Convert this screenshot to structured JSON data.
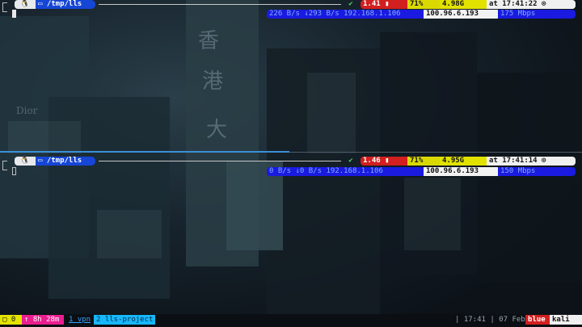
{
  "top_pane": {
    "os_icon": "linux-penguin-icon",
    "path": "/tmp/lls",
    "status_ok": "✔",
    "load": "1.41",
    "ram": "71%",
    "disk": "4.98G",
    "time": "at 17:41:22",
    "network": "226 B/s ↓293 B/s  192.168.1.106 ",
    "ip": "100.96.6.193",
    "speed": "175 Mbps"
  },
  "bottom_pane": {
    "os_icon": "linux-penguin-icon",
    "path": "/tmp/lls",
    "status_ok": "✔",
    "load": "1.46",
    "ram": "71%",
    "disk": "4.95G",
    "time": "at 17:41:14",
    "network": "0 B/s ↓0 B/s  192.168.1.106 ",
    "ip": "100.96.6.193",
    "speed": "150 Mbps"
  },
  "statusbar": {
    "count": "0",
    "uptime": "↑ 8h 28m",
    "window1": "1 vpn",
    "window2": "2 lls-project",
    "clock": "| 17:41 | 07 Feb",
    "session": "blue",
    "host": "kali"
  },
  "colors": {
    "accent_blue": "#1546d6",
    "load_red": "#d21f1f",
    "yellow": "#e2e200",
    "active_window": "#16b7ff",
    "divider": "#3b8fd6"
  }
}
